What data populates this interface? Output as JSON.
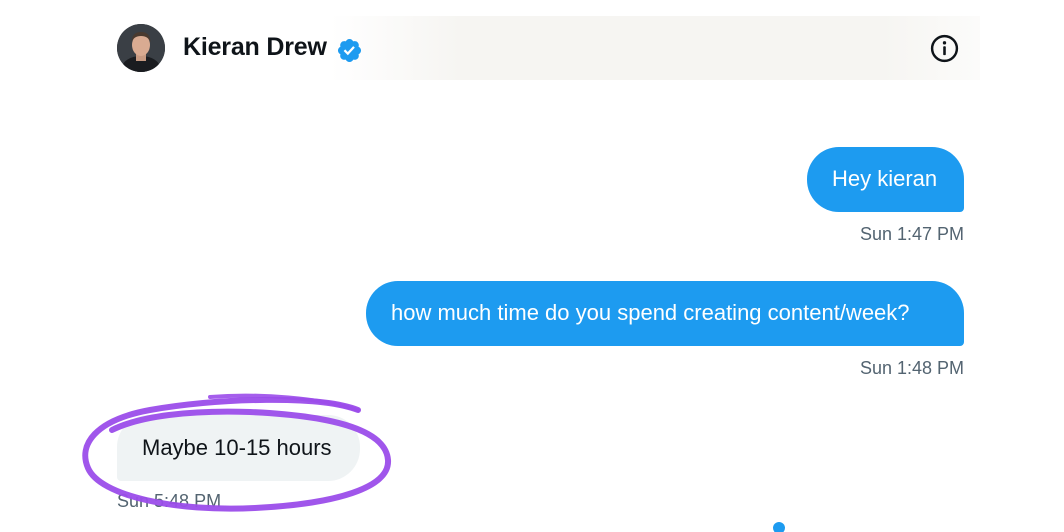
{
  "contact": {
    "name": "Kieran Drew",
    "verified": true,
    "avatar_icon": "profile-photo"
  },
  "header": {
    "info_icon": "info-icon"
  },
  "messages": [
    {
      "direction": "outgoing",
      "text": "Hey kieran",
      "time": "Sun 1:47 PM"
    },
    {
      "direction": "outgoing",
      "text": "how much time do you spend creating content/week?",
      "time": "Sun 1:48 PM"
    },
    {
      "direction": "incoming",
      "text": "Maybe 10-15 hours",
      "time": "Sun 5:48 PM"
    }
  ],
  "annotation": {
    "type": "hand-drawn circle",
    "color": "#9b4dea"
  },
  "colors": {
    "outgoing_bubble": "#1d9bf0",
    "incoming_bubble": "#eff3f4",
    "verified_badge": "#1d9bf0",
    "timestamp": "#536471"
  }
}
